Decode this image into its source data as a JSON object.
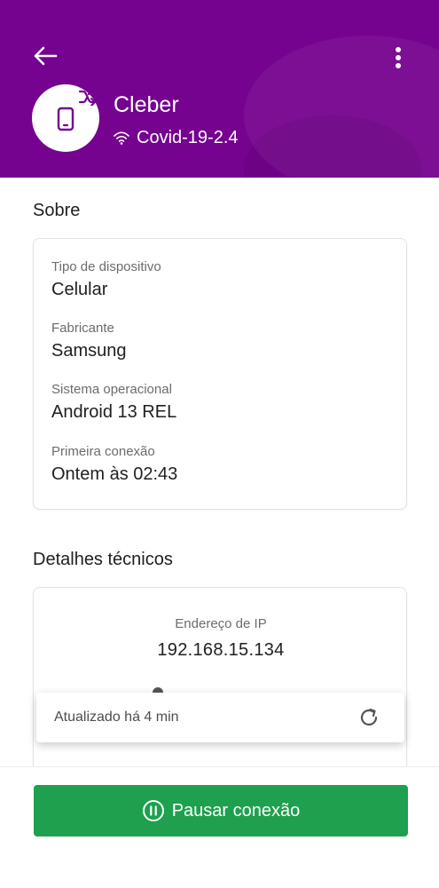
{
  "header": {
    "device_name": "Cleber",
    "network_name": "Covid-19-2.4",
    "background_color": "#75038f"
  },
  "icons": {
    "back": "arrow-left-icon",
    "menu": "more-vertical-icon",
    "device": "smartphone-icon",
    "shuffle": "shuffle-icon",
    "wifi": "wifi-icon",
    "refresh": "refresh-icon",
    "pause": "pause-circle-icon"
  },
  "about": {
    "title": "Sobre",
    "fields": [
      {
        "label": "Tipo de dispositivo",
        "value": "Celular"
      },
      {
        "label": "Fabricante",
        "value": "Samsung"
      },
      {
        "label": "Sistema operacional",
        "value": "Android 13 REL"
      },
      {
        "label": "Primeira conexão",
        "value": "Ontem às 02:43"
      }
    ]
  },
  "technical": {
    "title": "Detalhes técnicos",
    "ip_label": "Endereço de IP",
    "ip_value": "192.168.15.134"
  },
  "toast": {
    "text": "Atualizado há 4 min"
  },
  "actions": {
    "pause_label": "Pausar conexão",
    "pause_color": "#1ea04e"
  }
}
